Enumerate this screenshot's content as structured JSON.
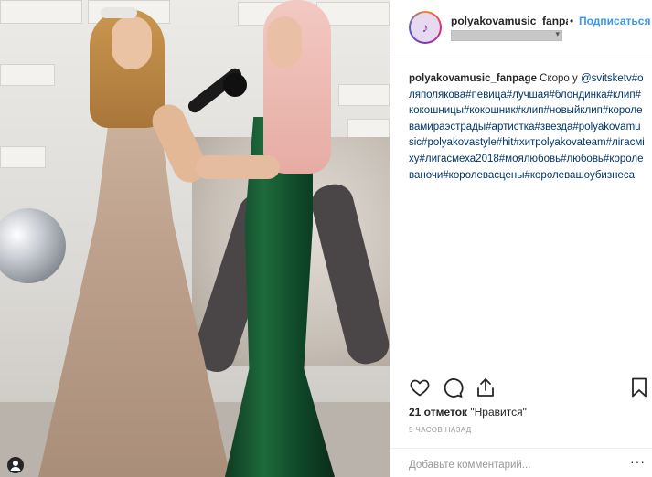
{
  "header": {
    "username": "polyakovamusic_fanpa",
    "separator": "•",
    "follow_label": "Подписаться"
  },
  "caption": {
    "username": "polyakovamusic_fanpage",
    "text": " Скоро у ",
    "mention": "@svitsketv",
    "hashtags": "#оляполякова#певица#лучшая#блондинка#клип#кокошницы#кокошник#клип#новыйклип#королевамираэстрады#артистка#звезда#polyakovamusic#polyakovastyle#hit#хитpolyakovateam#лігасміху#лигасмеха2018#моялюбовь#любовь#королеваночи#королевасцены#королевашоубизнеса"
  },
  "likes": {
    "count_text": "21 отметок",
    "label": " \"Нравится\""
  },
  "time": {
    "text": "5 ЧАСОВ НАЗАД"
  },
  "comment": {
    "placeholder": "Добавьте комментарий..."
  },
  "more": {
    "label": "···"
  },
  "colors": {
    "link": "#3897f0",
    "hashtag": "#003569",
    "muted": "#999999"
  },
  "icons": [
    "heart-icon",
    "comment-icon",
    "share-icon",
    "bookmark-icon",
    "user-tag-icon"
  ]
}
